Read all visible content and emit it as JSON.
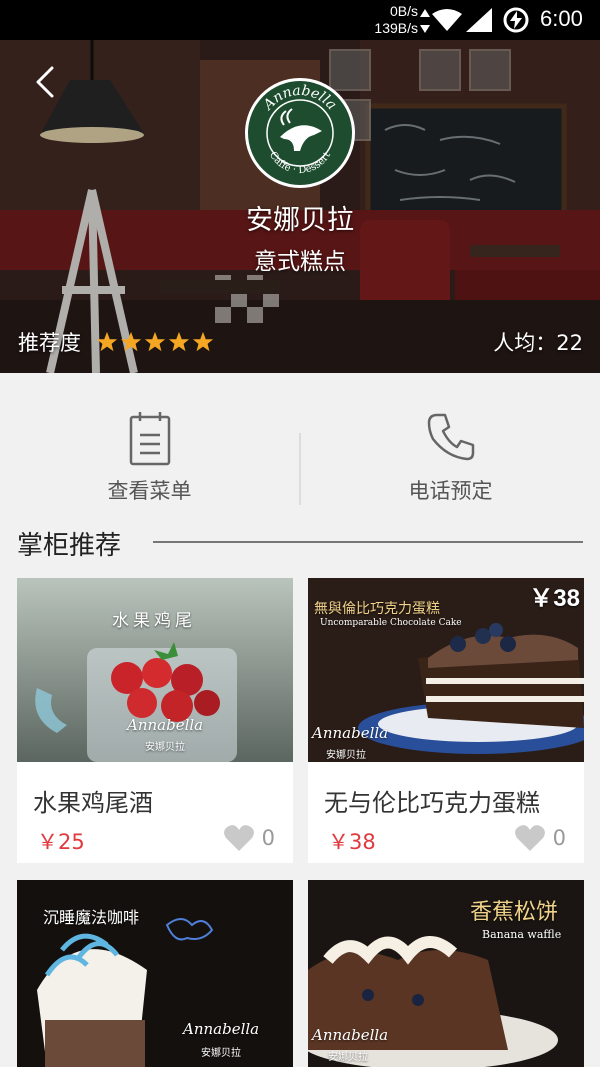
{
  "status_bar": {
    "net_down": "0B/s",
    "net_up": "139B/s",
    "time": "6:00"
  },
  "shop": {
    "logo_text": "Annabella Caffe · Dessert",
    "name": "安娜贝拉",
    "category": "意式糕点",
    "rating_label": "推荐度",
    "rating_stars": 5,
    "avg_price": "人均：22"
  },
  "actions": {
    "menu_label": "查看菜单",
    "phone_label": "电话预定"
  },
  "section": {
    "title": "掌柜推荐"
  },
  "items": [
    {
      "name": "水果鸡尾酒",
      "price": "￥25",
      "likes": "0",
      "photo_caption": "水果鸡尾",
      "photo_brand": "Annabella",
      "photo_brand_sub": "安娜贝拉"
    },
    {
      "name": "无与伦比巧克力蛋糕",
      "price": "￥38",
      "likes": "0",
      "badge": "￥38",
      "photo_caption": "無與倫比巧克力蛋糕",
      "photo_caption_en": "Uncomparable Chocolate Cake",
      "photo_brand": "Annabella",
      "photo_brand_sub": "安娜贝拉"
    },
    {
      "photo_caption": "沉睡魔法咖啡",
      "photo_brand": "Annabella",
      "photo_brand_sub": "安娜贝拉"
    },
    {
      "photo_caption": "香蕉松饼",
      "photo_caption_en": "Banana waffle",
      "photo_brand": "Annabella",
      "photo_brand_sub": "安娜贝拉"
    }
  ],
  "colors": {
    "price_red": "#e0393e",
    "logo_green": "#1d4d2e",
    "star_orange": "#f5a623"
  }
}
